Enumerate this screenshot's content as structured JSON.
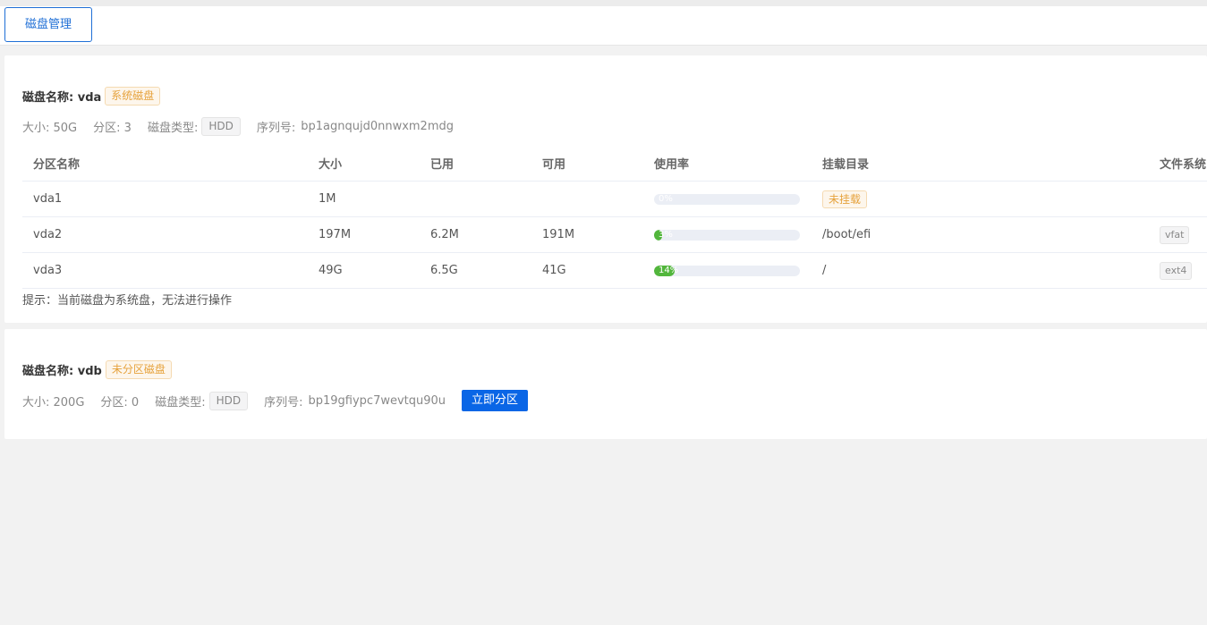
{
  "tab": {
    "label": "磁盘管理"
  },
  "disks": [
    {
      "title": "磁盘名称: vda",
      "badge": "系统磁盘",
      "size": "大小: 50G",
      "partitions": "分区: 3",
      "type_label": "磁盘类型:",
      "type": "HDD",
      "serial_label": "序列号:",
      "serial": "bp1agnqujd0nnwxm2mdg",
      "columns": [
        "分区名称",
        "大小",
        "已用",
        "可用",
        "使用率",
        "挂载目录",
        "文件系统"
      ],
      "rows": [
        {
          "name": "vda1",
          "size": "1M",
          "used": "",
          "avail": "",
          "usage": 0,
          "usage_label": "0%",
          "mount": "未挂载",
          "mounted": false,
          "fs": ""
        },
        {
          "name": "vda2",
          "size": "197M",
          "used": "6.2M",
          "avail": "191M",
          "usage": 3,
          "usage_label": "3%",
          "mount": "/boot/efi",
          "mounted": true,
          "fs": "vfat"
        },
        {
          "name": "vda3",
          "size": "49G",
          "used": "6.5G",
          "avail": "41G",
          "usage": 14,
          "usage_label": "14%",
          "mount": "/",
          "mounted": true,
          "fs": "ext4"
        }
      ],
      "hint": "提示：当前磁盘为系统盘，无法进行操作"
    },
    {
      "title": "磁盘名称: vdb",
      "badge": "未分区磁盘",
      "size": "大小: 200G",
      "partitions": "分区: 0",
      "type_label": "磁盘类型:",
      "type": "HDD",
      "serial_label": "序列号:",
      "serial": "bp19gfiypc7wevtqu90u",
      "action": "立即分区"
    }
  ],
  "colors": {
    "accent": "#1f6fd6",
    "button": "#0a66e6",
    "progress": "#52b63c",
    "warning": "#e6a23c"
  }
}
